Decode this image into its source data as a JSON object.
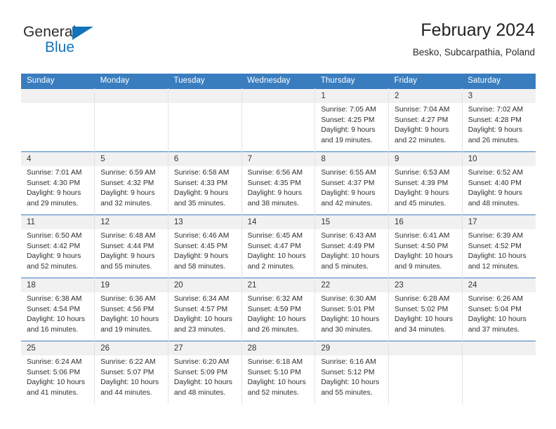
{
  "brand": {
    "name_part1": "General",
    "name_part2": "Blue",
    "triangle_color": "#1273b9"
  },
  "header": {
    "title": "February 2024",
    "subtitle": "Besko, Subcarpathia, Poland"
  },
  "theme": {
    "header_blue": "#3a7dbf",
    "daynum_band": "#f1f1f1",
    "text": "#2e2e2e"
  },
  "weekdays": [
    "Sunday",
    "Monday",
    "Tuesday",
    "Wednesday",
    "Thursday",
    "Friday",
    "Saturday"
  ],
  "weeks": [
    [
      {
        "day": "",
        "sunrise": "",
        "sunset": "",
        "daylight1": "",
        "daylight2": ""
      },
      {
        "day": "",
        "sunrise": "",
        "sunset": "",
        "daylight1": "",
        "daylight2": ""
      },
      {
        "day": "",
        "sunrise": "",
        "sunset": "",
        "daylight1": "",
        "daylight2": ""
      },
      {
        "day": "",
        "sunrise": "",
        "sunset": "",
        "daylight1": "",
        "daylight2": ""
      },
      {
        "day": "1",
        "sunrise": "Sunrise: 7:05 AM",
        "sunset": "Sunset: 4:25 PM",
        "daylight1": "Daylight: 9 hours",
        "daylight2": "and 19 minutes."
      },
      {
        "day": "2",
        "sunrise": "Sunrise: 7:04 AM",
        "sunset": "Sunset: 4:27 PM",
        "daylight1": "Daylight: 9 hours",
        "daylight2": "and 22 minutes."
      },
      {
        "day": "3",
        "sunrise": "Sunrise: 7:02 AM",
        "sunset": "Sunset: 4:28 PM",
        "daylight1": "Daylight: 9 hours",
        "daylight2": "and 26 minutes."
      }
    ],
    [
      {
        "day": "4",
        "sunrise": "Sunrise: 7:01 AM",
        "sunset": "Sunset: 4:30 PM",
        "daylight1": "Daylight: 9 hours",
        "daylight2": "and 29 minutes."
      },
      {
        "day": "5",
        "sunrise": "Sunrise: 6:59 AM",
        "sunset": "Sunset: 4:32 PM",
        "daylight1": "Daylight: 9 hours",
        "daylight2": "and 32 minutes."
      },
      {
        "day": "6",
        "sunrise": "Sunrise: 6:58 AM",
        "sunset": "Sunset: 4:33 PM",
        "daylight1": "Daylight: 9 hours",
        "daylight2": "and 35 minutes."
      },
      {
        "day": "7",
        "sunrise": "Sunrise: 6:56 AM",
        "sunset": "Sunset: 4:35 PM",
        "daylight1": "Daylight: 9 hours",
        "daylight2": "and 38 minutes."
      },
      {
        "day": "8",
        "sunrise": "Sunrise: 6:55 AM",
        "sunset": "Sunset: 4:37 PM",
        "daylight1": "Daylight: 9 hours",
        "daylight2": "and 42 minutes."
      },
      {
        "day": "9",
        "sunrise": "Sunrise: 6:53 AM",
        "sunset": "Sunset: 4:39 PM",
        "daylight1": "Daylight: 9 hours",
        "daylight2": "and 45 minutes."
      },
      {
        "day": "10",
        "sunrise": "Sunrise: 6:52 AM",
        "sunset": "Sunset: 4:40 PM",
        "daylight1": "Daylight: 9 hours",
        "daylight2": "and 48 minutes."
      }
    ],
    [
      {
        "day": "11",
        "sunrise": "Sunrise: 6:50 AM",
        "sunset": "Sunset: 4:42 PM",
        "daylight1": "Daylight: 9 hours",
        "daylight2": "and 52 minutes."
      },
      {
        "day": "12",
        "sunrise": "Sunrise: 6:48 AM",
        "sunset": "Sunset: 4:44 PM",
        "daylight1": "Daylight: 9 hours",
        "daylight2": "and 55 minutes."
      },
      {
        "day": "13",
        "sunrise": "Sunrise: 6:46 AM",
        "sunset": "Sunset: 4:45 PM",
        "daylight1": "Daylight: 9 hours",
        "daylight2": "and 58 minutes."
      },
      {
        "day": "14",
        "sunrise": "Sunrise: 6:45 AM",
        "sunset": "Sunset: 4:47 PM",
        "daylight1": "Daylight: 10 hours",
        "daylight2": "and 2 minutes."
      },
      {
        "day": "15",
        "sunrise": "Sunrise: 6:43 AM",
        "sunset": "Sunset: 4:49 PM",
        "daylight1": "Daylight: 10 hours",
        "daylight2": "and 5 minutes."
      },
      {
        "day": "16",
        "sunrise": "Sunrise: 6:41 AM",
        "sunset": "Sunset: 4:50 PM",
        "daylight1": "Daylight: 10 hours",
        "daylight2": "and 9 minutes."
      },
      {
        "day": "17",
        "sunrise": "Sunrise: 6:39 AM",
        "sunset": "Sunset: 4:52 PM",
        "daylight1": "Daylight: 10 hours",
        "daylight2": "and 12 minutes."
      }
    ],
    [
      {
        "day": "18",
        "sunrise": "Sunrise: 6:38 AM",
        "sunset": "Sunset: 4:54 PM",
        "daylight1": "Daylight: 10 hours",
        "daylight2": "and 16 minutes."
      },
      {
        "day": "19",
        "sunrise": "Sunrise: 6:36 AM",
        "sunset": "Sunset: 4:56 PM",
        "daylight1": "Daylight: 10 hours",
        "daylight2": "and 19 minutes."
      },
      {
        "day": "20",
        "sunrise": "Sunrise: 6:34 AM",
        "sunset": "Sunset: 4:57 PM",
        "daylight1": "Daylight: 10 hours",
        "daylight2": "and 23 minutes."
      },
      {
        "day": "21",
        "sunrise": "Sunrise: 6:32 AM",
        "sunset": "Sunset: 4:59 PM",
        "daylight1": "Daylight: 10 hours",
        "daylight2": "and 26 minutes."
      },
      {
        "day": "22",
        "sunrise": "Sunrise: 6:30 AM",
        "sunset": "Sunset: 5:01 PM",
        "daylight1": "Daylight: 10 hours",
        "daylight2": "and 30 minutes."
      },
      {
        "day": "23",
        "sunrise": "Sunrise: 6:28 AM",
        "sunset": "Sunset: 5:02 PM",
        "daylight1": "Daylight: 10 hours",
        "daylight2": "and 34 minutes."
      },
      {
        "day": "24",
        "sunrise": "Sunrise: 6:26 AM",
        "sunset": "Sunset: 5:04 PM",
        "daylight1": "Daylight: 10 hours",
        "daylight2": "and 37 minutes."
      }
    ],
    [
      {
        "day": "25",
        "sunrise": "Sunrise: 6:24 AM",
        "sunset": "Sunset: 5:06 PM",
        "daylight1": "Daylight: 10 hours",
        "daylight2": "and 41 minutes."
      },
      {
        "day": "26",
        "sunrise": "Sunrise: 6:22 AM",
        "sunset": "Sunset: 5:07 PM",
        "daylight1": "Daylight: 10 hours",
        "daylight2": "and 44 minutes."
      },
      {
        "day": "27",
        "sunrise": "Sunrise: 6:20 AM",
        "sunset": "Sunset: 5:09 PM",
        "daylight1": "Daylight: 10 hours",
        "daylight2": "and 48 minutes."
      },
      {
        "day": "28",
        "sunrise": "Sunrise: 6:18 AM",
        "sunset": "Sunset: 5:10 PM",
        "daylight1": "Daylight: 10 hours",
        "daylight2": "and 52 minutes."
      },
      {
        "day": "29",
        "sunrise": "Sunrise: 6:16 AM",
        "sunset": "Sunset: 5:12 PM",
        "daylight1": "Daylight: 10 hours",
        "daylight2": "and 55 minutes."
      },
      {
        "day": "",
        "sunrise": "",
        "sunset": "",
        "daylight1": "",
        "daylight2": ""
      },
      {
        "day": "",
        "sunrise": "",
        "sunset": "",
        "daylight1": "",
        "daylight2": ""
      }
    ]
  ]
}
